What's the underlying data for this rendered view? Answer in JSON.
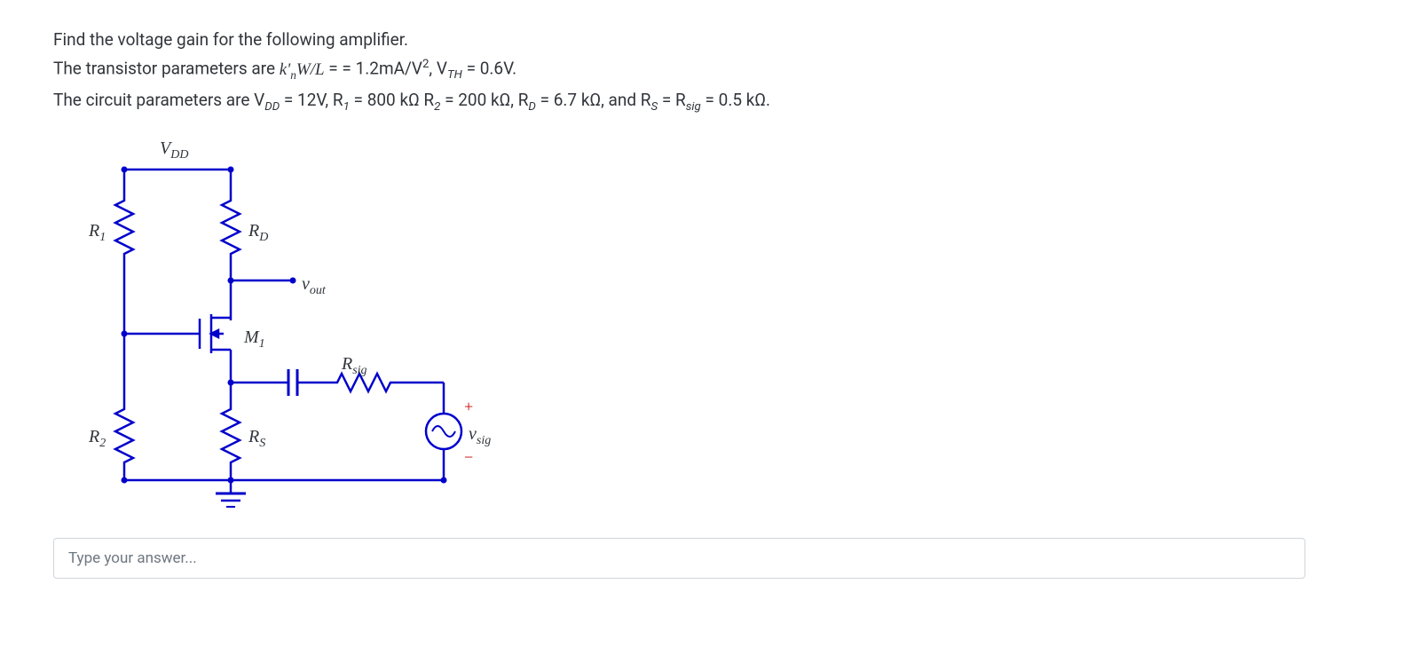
{
  "question": {
    "line1": "Find the voltage gain for the following amplifier.",
    "line2_pre": "The transistor parameters are ",
    "kn_expr": "k'",
    "kn_sub": "n",
    "wl_expr": "W/L",
    "eq_val": " = = 1.2mA/V",
    "sq": "2",
    "vth_pre": ", V",
    "vth_sub": "TH",
    "vth_val": " = 0.6V.",
    "line3_pre": "The circuit parameters are V",
    "vdd_sub": "DD",
    "vdd_val": " = 12V, R",
    "r1_sub": "1",
    "r1_val": " = 800 kΩ  R",
    "r2_sub": "2",
    "r2_val": " = 200 kΩ, R",
    "rd_sub": "D",
    "rd_val": " = 6.7 kΩ, and R",
    "rs_sub": "S",
    "rs_eq": " = R",
    "rsig_sub": "sig",
    "rsig_val": " = 0.5 kΩ."
  },
  "labels": {
    "vdd": "V",
    "vdd_sub": "DD",
    "r1": "R",
    "r1_sub": "1",
    "r2": "R",
    "r2_sub": "2",
    "rd": "R",
    "rd_sub": "D",
    "rs": "R",
    "rs_sub": "S",
    "m1": "M",
    "m1_sub": "1",
    "vout": "v",
    "vout_sub": "out",
    "rsig": "R",
    "rsig_sub": "sig",
    "vsig": "v",
    "vsig_sub": "sig",
    "plus": "+",
    "minus": "−"
  },
  "answer": {
    "placeholder": "Type your answer..."
  }
}
